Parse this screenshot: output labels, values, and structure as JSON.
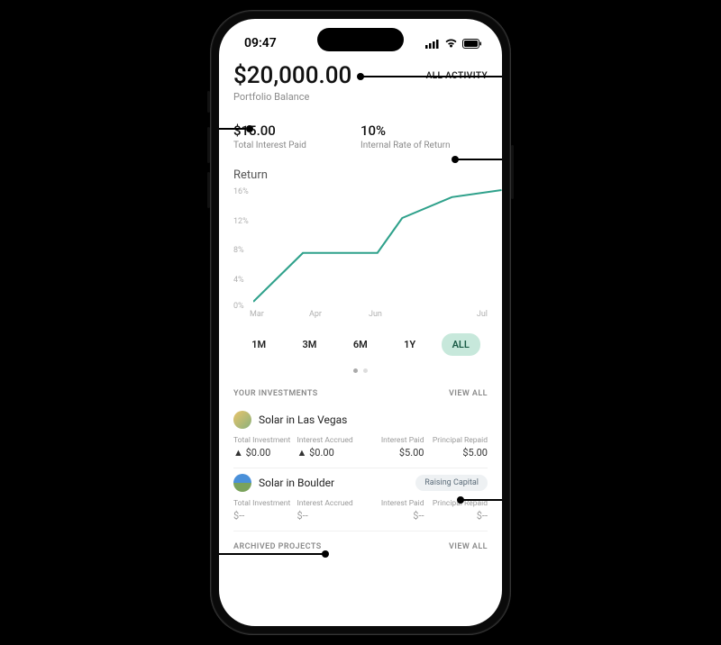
{
  "statusbar": {
    "time": "09:47"
  },
  "header": {
    "balance": "$20,000.00",
    "balance_label": "Portfolio Balance",
    "all_activity": "ALL ACTIVITY"
  },
  "metrics": {
    "interest_paid": {
      "value": "$15.00",
      "label": "Total Interest Paid"
    },
    "irr": {
      "value": "10%",
      "label": "Internal Rate of Return"
    }
  },
  "chart": {
    "title": "Return"
  },
  "chart_data": {
    "type": "line",
    "title": "Return",
    "xlabel": "",
    "ylabel": "",
    "ylim": [
      0,
      16
    ],
    "yticks": [
      "16%",
      "12%",
      "8%",
      "4%",
      "0%"
    ],
    "categories": [
      "Mar",
      "Apr",
      "Jun",
      "Jul"
    ],
    "x": [
      0,
      1,
      2,
      2.5,
      3,
      4,
      5
    ],
    "values": [
      0,
      7,
      7,
      7,
      12,
      15,
      16
    ],
    "color": "#2fa18b"
  },
  "ranges": {
    "items": [
      "1M",
      "3M",
      "6M",
      "1Y",
      "ALL"
    ],
    "active": "ALL"
  },
  "sections": {
    "investments": {
      "title": "YOUR INVESTMENTS",
      "view_all": "VIEW ALL"
    },
    "archived": {
      "title": "ARCHIVED PROJECTS",
      "view_all": "VIEW ALL"
    }
  },
  "investments": [
    {
      "name": "Solar in Las Vegas",
      "badge": null,
      "cols": {
        "total_investment": {
          "label": "Total Investment",
          "value": "▲ $0.00"
        },
        "interest_accrued": {
          "label": "Interest Accrued",
          "value": "▲ $0.00"
        },
        "interest_paid": {
          "label": "Interest Paid",
          "value": "$5.00"
        },
        "principal_repaid": {
          "label": "Principal Repaid",
          "value": "$5.00"
        }
      }
    },
    {
      "name": "Solar in Boulder",
      "badge": "Raising Capital",
      "cols": {
        "total_investment": {
          "label": "Total Investment",
          "value": "$--"
        },
        "interest_accrued": {
          "label": "Interest Accrued",
          "value": "$--"
        },
        "interest_paid": {
          "label": "Interest Paid",
          "value": "$--"
        },
        "principal_repaid": {
          "label": "Principal Repaid",
          "value": "$--"
        }
      }
    }
  ]
}
